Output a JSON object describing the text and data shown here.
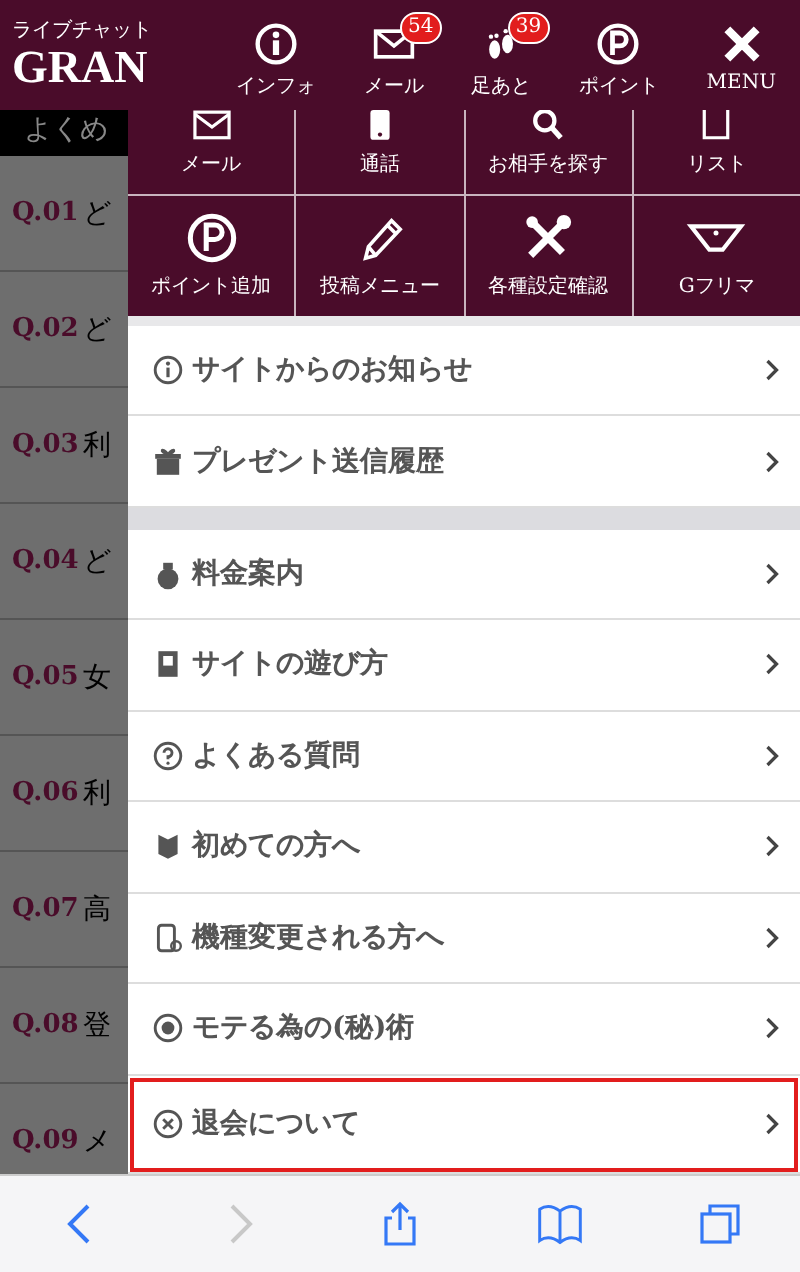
{
  "header": {
    "logo_caption": "ライブチャット",
    "logo": "GRAN",
    "nav": [
      {
        "label": "インフォ"
      },
      {
        "label": "メール",
        "badge": "54"
      },
      {
        "label": "足あと",
        "badge": "39"
      },
      {
        "label": "ポイント"
      },
      {
        "label": "MENU"
      }
    ]
  },
  "background_page": {
    "heading": "よくめ",
    "questions": [
      {
        "number": "Q.01",
        "text": "ど"
      },
      {
        "number": "Q.02",
        "text": "ど"
      },
      {
        "number": "Q.03",
        "text": "利"
      },
      {
        "number": "Q.04",
        "text": "ど"
      },
      {
        "number": "Q.05",
        "text": "女"
      },
      {
        "number": "Q.06",
        "text": "利"
      },
      {
        "number": "Q.07",
        "text": "高"
      },
      {
        "number": "Q.08",
        "text": "登"
      },
      {
        "number": "Q.09",
        "text": "メ"
      }
    ]
  },
  "menu_grid": [
    {
      "label": "メール"
    },
    {
      "label": "通話"
    },
    {
      "label": "お相手を探す"
    },
    {
      "label": "リスト"
    },
    {
      "label": "ポイント追加"
    },
    {
      "label": "投稿メニュー"
    },
    {
      "label": "各種設定確認"
    },
    {
      "label": "Gフリマ"
    }
  ],
  "menu_groups": [
    {
      "items": [
        {
          "label": "サイトからのお知らせ",
          "highlighted": false
        },
        {
          "label": "プレゼント送信履歴",
          "highlighted": false
        }
      ]
    },
    {
      "items": [
        {
          "label": "料金案内",
          "highlighted": false
        },
        {
          "label": "サイトの遊び方",
          "highlighted": false
        },
        {
          "label": "よくある質問",
          "highlighted": false
        },
        {
          "label": "初めての方へ",
          "highlighted": false
        },
        {
          "label": "機種変更される方へ",
          "highlighted": false
        },
        {
          "label": "モテる為の(秘)術",
          "highlighted": false
        },
        {
          "label": "退会について",
          "highlighted": true
        }
      ]
    }
  ],
  "browser_toolbar": {
    "back": {
      "disabled": false
    },
    "forward": {
      "disabled": true
    }
  }
}
